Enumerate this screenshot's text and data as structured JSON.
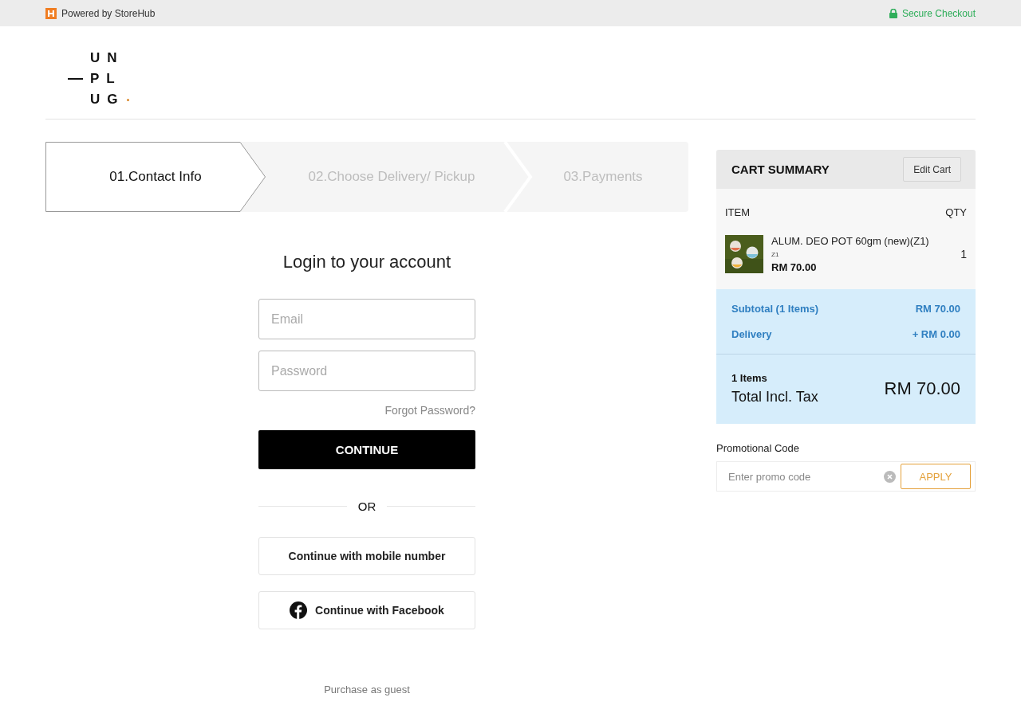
{
  "top_bar": {
    "powered_by": "Powered by StoreHub",
    "secure": "Secure Checkout"
  },
  "logo": {
    "rows": [
      {
        "text": "UN",
        "lead_dash": false,
        "trail_dot": false
      },
      {
        "text": "PL",
        "lead_dash": true,
        "trail_dot": false
      },
      {
        "text": "UG",
        "lead_dash": false,
        "trail_dot": true
      }
    ]
  },
  "steps": [
    {
      "label": "01.Contact Info",
      "selected": true
    },
    {
      "label": "02.Choose Delivery/ Pickup",
      "selected": false
    },
    {
      "label": "03.Payments",
      "selected": false
    }
  ],
  "login": {
    "title": "Login to your account",
    "email": {
      "placeholder": "Email"
    },
    "password": {
      "placeholder": "Password"
    },
    "forgot": "Forgot Password?",
    "continue": "CONTINUE",
    "or": "OR",
    "mobile": "Continue with mobile number",
    "facebook": "Continue with Facebook",
    "guest": "Purchase as guest"
  },
  "cart": {
    "title": "CART SUMMARY",
    "edit": "Edit Cart",
    "columns": [
      "ITEM",
      "QTY"
    ],
    "items": [
      {
        "kind": "picture",
        "name": "ALUM. DEO POT 60gm (new)(Z1)",
        "variant": "Z1",
        "price": "RM 70.00",
        "qty": "1"
      }
    ],
    "subtotal_label": "Subtotal (1 Items)",
    "subtotal": "RM 70.00",
    "delivery_label": "Delivery",
    "delivery": "+ RM 0.00",
    "items_count": "1 Items",
    "total_label": "Total Incl. Tax",
    "total": "RM 70.00",
    "promo_label": "Promotional Code",
    "promo": {
      "placeholder": "Enter promo code"
    },
    "apply": "APPLY"
  }
}
